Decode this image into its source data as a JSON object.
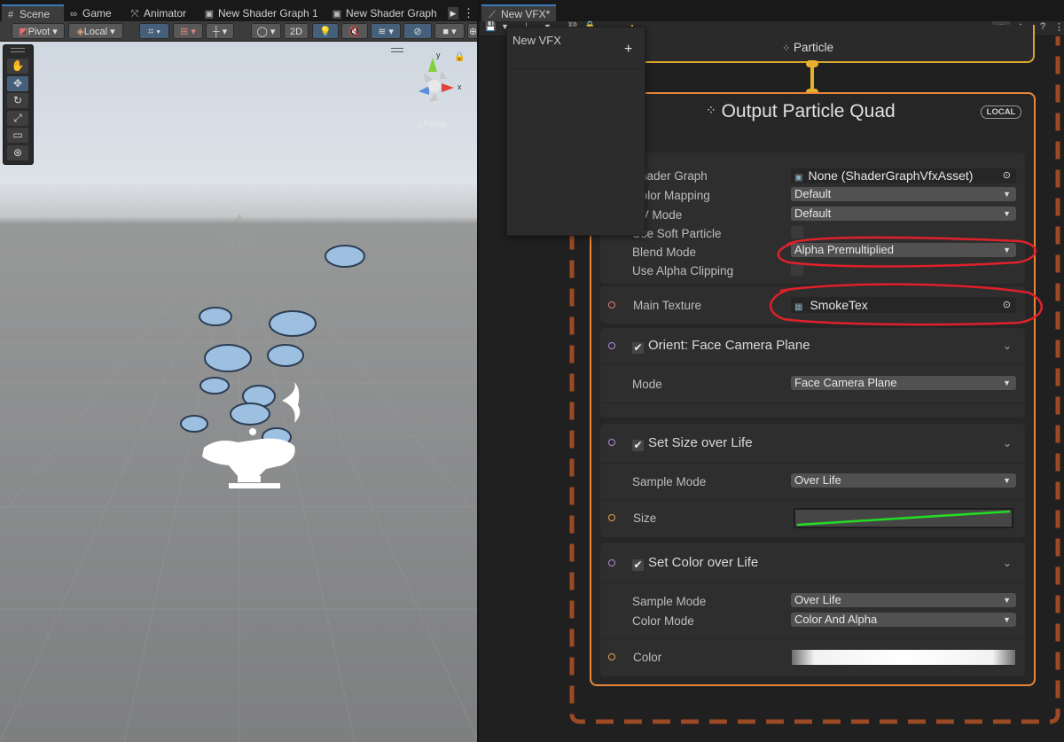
{
  "scene_tabs": [
    {
      "label": "Scene",
      "icon": "#"
    },
    {
      "label": "Game",
      "icon": "∞"
    },
    {
      "label": "Animator",
      "icon": "⤧"
    },
    {
      "label": "New Shader Graph 1",
      "icon": "▣"
    },
    {
      "label": "New Shader Graph",
      "icon": "▣"
    }
  ],
  "vfx_tab": {
    "label": "New VFX*"
  },
  "toolbar": {
    "pivot": "Pivot",
    "local": "Local",
    "mode_2d": "2D"
  },
  "gizmo": {
    "axis_x": "x",
    "axis_y": "y",
    "persp": "◁ Persp"
  },
  "blackboard": {
    "title": "New VFX",
    "add": "+"
  },
  "particle_context": {
    "label": "Particle"
  },
  "output": {
    "title": "Output Particle Quad",
    "badge": "LOCAL",
    "properties": [
      {
        "label": "Shader Graph",
        "value": "None (ShaderGraphVfxAsset)"
      },
      {
        "label": "Color Mapping",
        "value": "Default"
      },
      {
        "label": "UV Mode",
        "value": "Default"
      },
      {
        "label": "Use Soft Particle",
        "value": ""
      },
      {
        "label": "Blend Mode",
        "value": "Alpha Premultiplied"
      },
      {
        "label": "Use Alpha Clipping",
        "value": ""
      }
    ],
    "main_texture": {
      "label": "Main Texture",
      "value": "SmokeTex"
    }
  },
  "orient_block": {
    "title": "Orient: Face Camera Plane",
    "mode_label": "Mode",
    "mode_value": "Face Camera Plane"
  },
  "size_block": {
    "title": "Set Size over Life",
    "sample_label": "Sample Mode",
    "sample_value": "Over Life",
    "size_label": "Size"
  },
  "color_block": {
    "title": "Set Color over Life",
    "sample_label": "Sample Mode",
    "sample_value": "Over Life",
    "color_mode_label": "Color Mode",
    "color_mode_value": "Color And Alpha",
    "color_label": "Color"
  },
  "colors": {
    "accent": "#3a79bb",
    "context_border": "#d9a430",
    "output_border": "#e8873a",
    "annotation": "#e0202a",
    "dashed_border": "#a0522d",
    "curve": "#22dd22"
  }
}
